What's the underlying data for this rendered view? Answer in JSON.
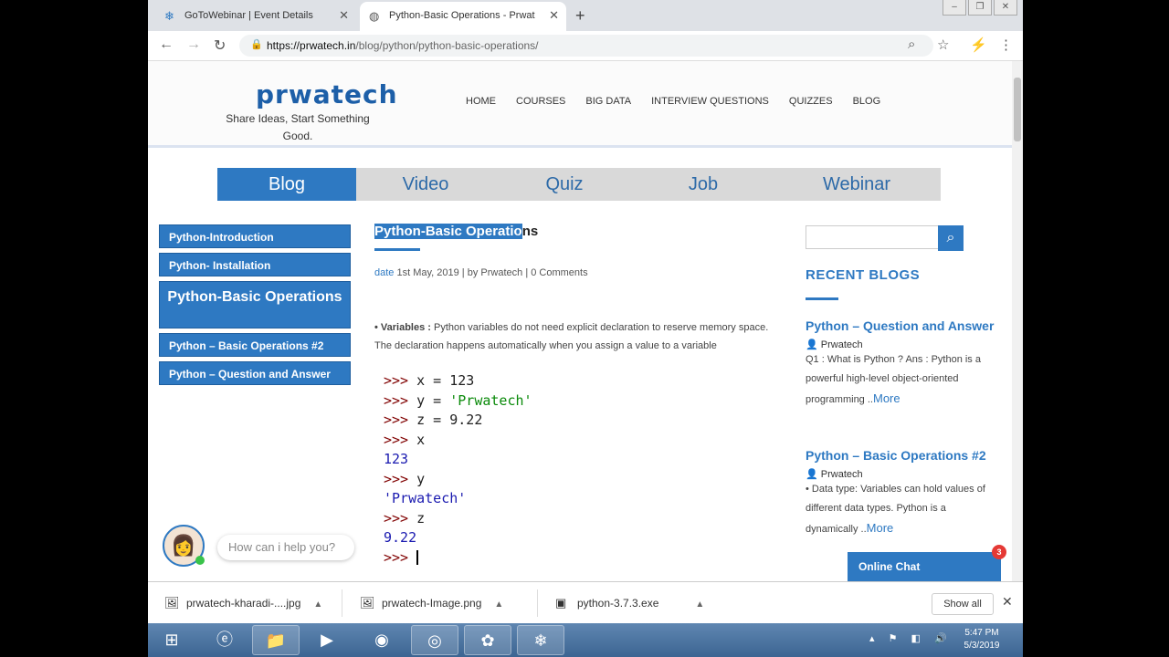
{
  "browser": {
    "tabs": [
      {
        "title": "GoToWebinar | Event Details",
        "icon": "snowflake-icon"
      },
      {
        "title": "Python-Basic Operations - Prwat",
        "icon": "globe-icon"
      }
    ],
    "url_host": "https://prwatech.in",
    "url_path": "/blog/python/python-basic-operations/"
  },
  "site": {
    "logo": "prwatech",
    "tagline": "Share Ideas, Start Something Good.",
    "nav": [
      "HOME",
      "COURSES",
      "BIG DATA",
      "INTERVIEW QUESTIONS",
      "QUIZZES",
      "BLOG"
    ],
    "tabs": [
      "Blog",
      "Video",
      "Quiz",
      "Job",
      "Webinar"
    ],
    "active_tab": "Blog"
  },
  "sidenav": [
    {
      "label": "Python-Introduction"
    },
    {
      "label": "Python- Installation"
    },
    {
      "label": "Python-Basic Operations",
      "current": true
    },
    {
      "label": "Python – Basic Operations #2"
    },
    {
      "label": "Python – Question and Answer"
    }
  ],
  "article": {
    "title_selected": "Python-Basic Operatio",
    "title_rest": "ns",
    "meta_date_label": "date",
    "meta_date": " 1st May, 2019 | by ",
    "meta_author": "Prwatech",
    "meta_sep": " | ",
    "meta_comments": "0 Comments",
    "vars_label": "• Variables : ",
    "vars_text": "Python variables do not need explicit declaration to reserve memory space. The declaration happens automatically when you assign a value to a variable",
    "code": {
      "l1": " x = 123",
      "l2a": " y = ",
      "l2b": "'Prwatech'",
      "l3": " z = 9.22",
      "l4": " x",
      "o4": "123",
      "l5": " y",
      "o5": "'Prwatech'",
      "l6": " z",
      "o6": "9.22",
      "prompt": ">>>"
    }
  },
  "sidebar": {
    "search_placeholder": "",
    "recent_title": "RECENT BLOGS",
    "posts": [
      {
        "title": "Python – Question and Answer",
        "author": "Prwatech",
        "excerpt": "Q1 : What is Python ? Ans : Python is a powerful high-level object-oriented programming ..",
        "more": "More"
      },
      {
        "title": "Python – Basic Operations #2",
        "author": "Prwatech",
        "excerpt": "• Data type: Variables can hold values of different data types. Python is a dynamically ..",
        "more": "More"
      }
    ]
  },
  "chat": {
    "prompt": "How can i help you?",
    "online_label": "Online Chat",
    "badge": "3"
  },
  "downloads": [
    {
      "name": "prwatech-kharadi-....jpg",
      "icon": "image-icon"
    },
    {
      "name": "prwatech-Image.png",
      "icon": "image-icon"
    },
    {
      "name": "python-3.7.3.exe",
      "icon": "exe-icon"
    }
  ],
  "downloads_show_all": "Show all",
  "clock": {
    "time": "5:47 PM",
    "date": "5/3/2019"
  }
}
